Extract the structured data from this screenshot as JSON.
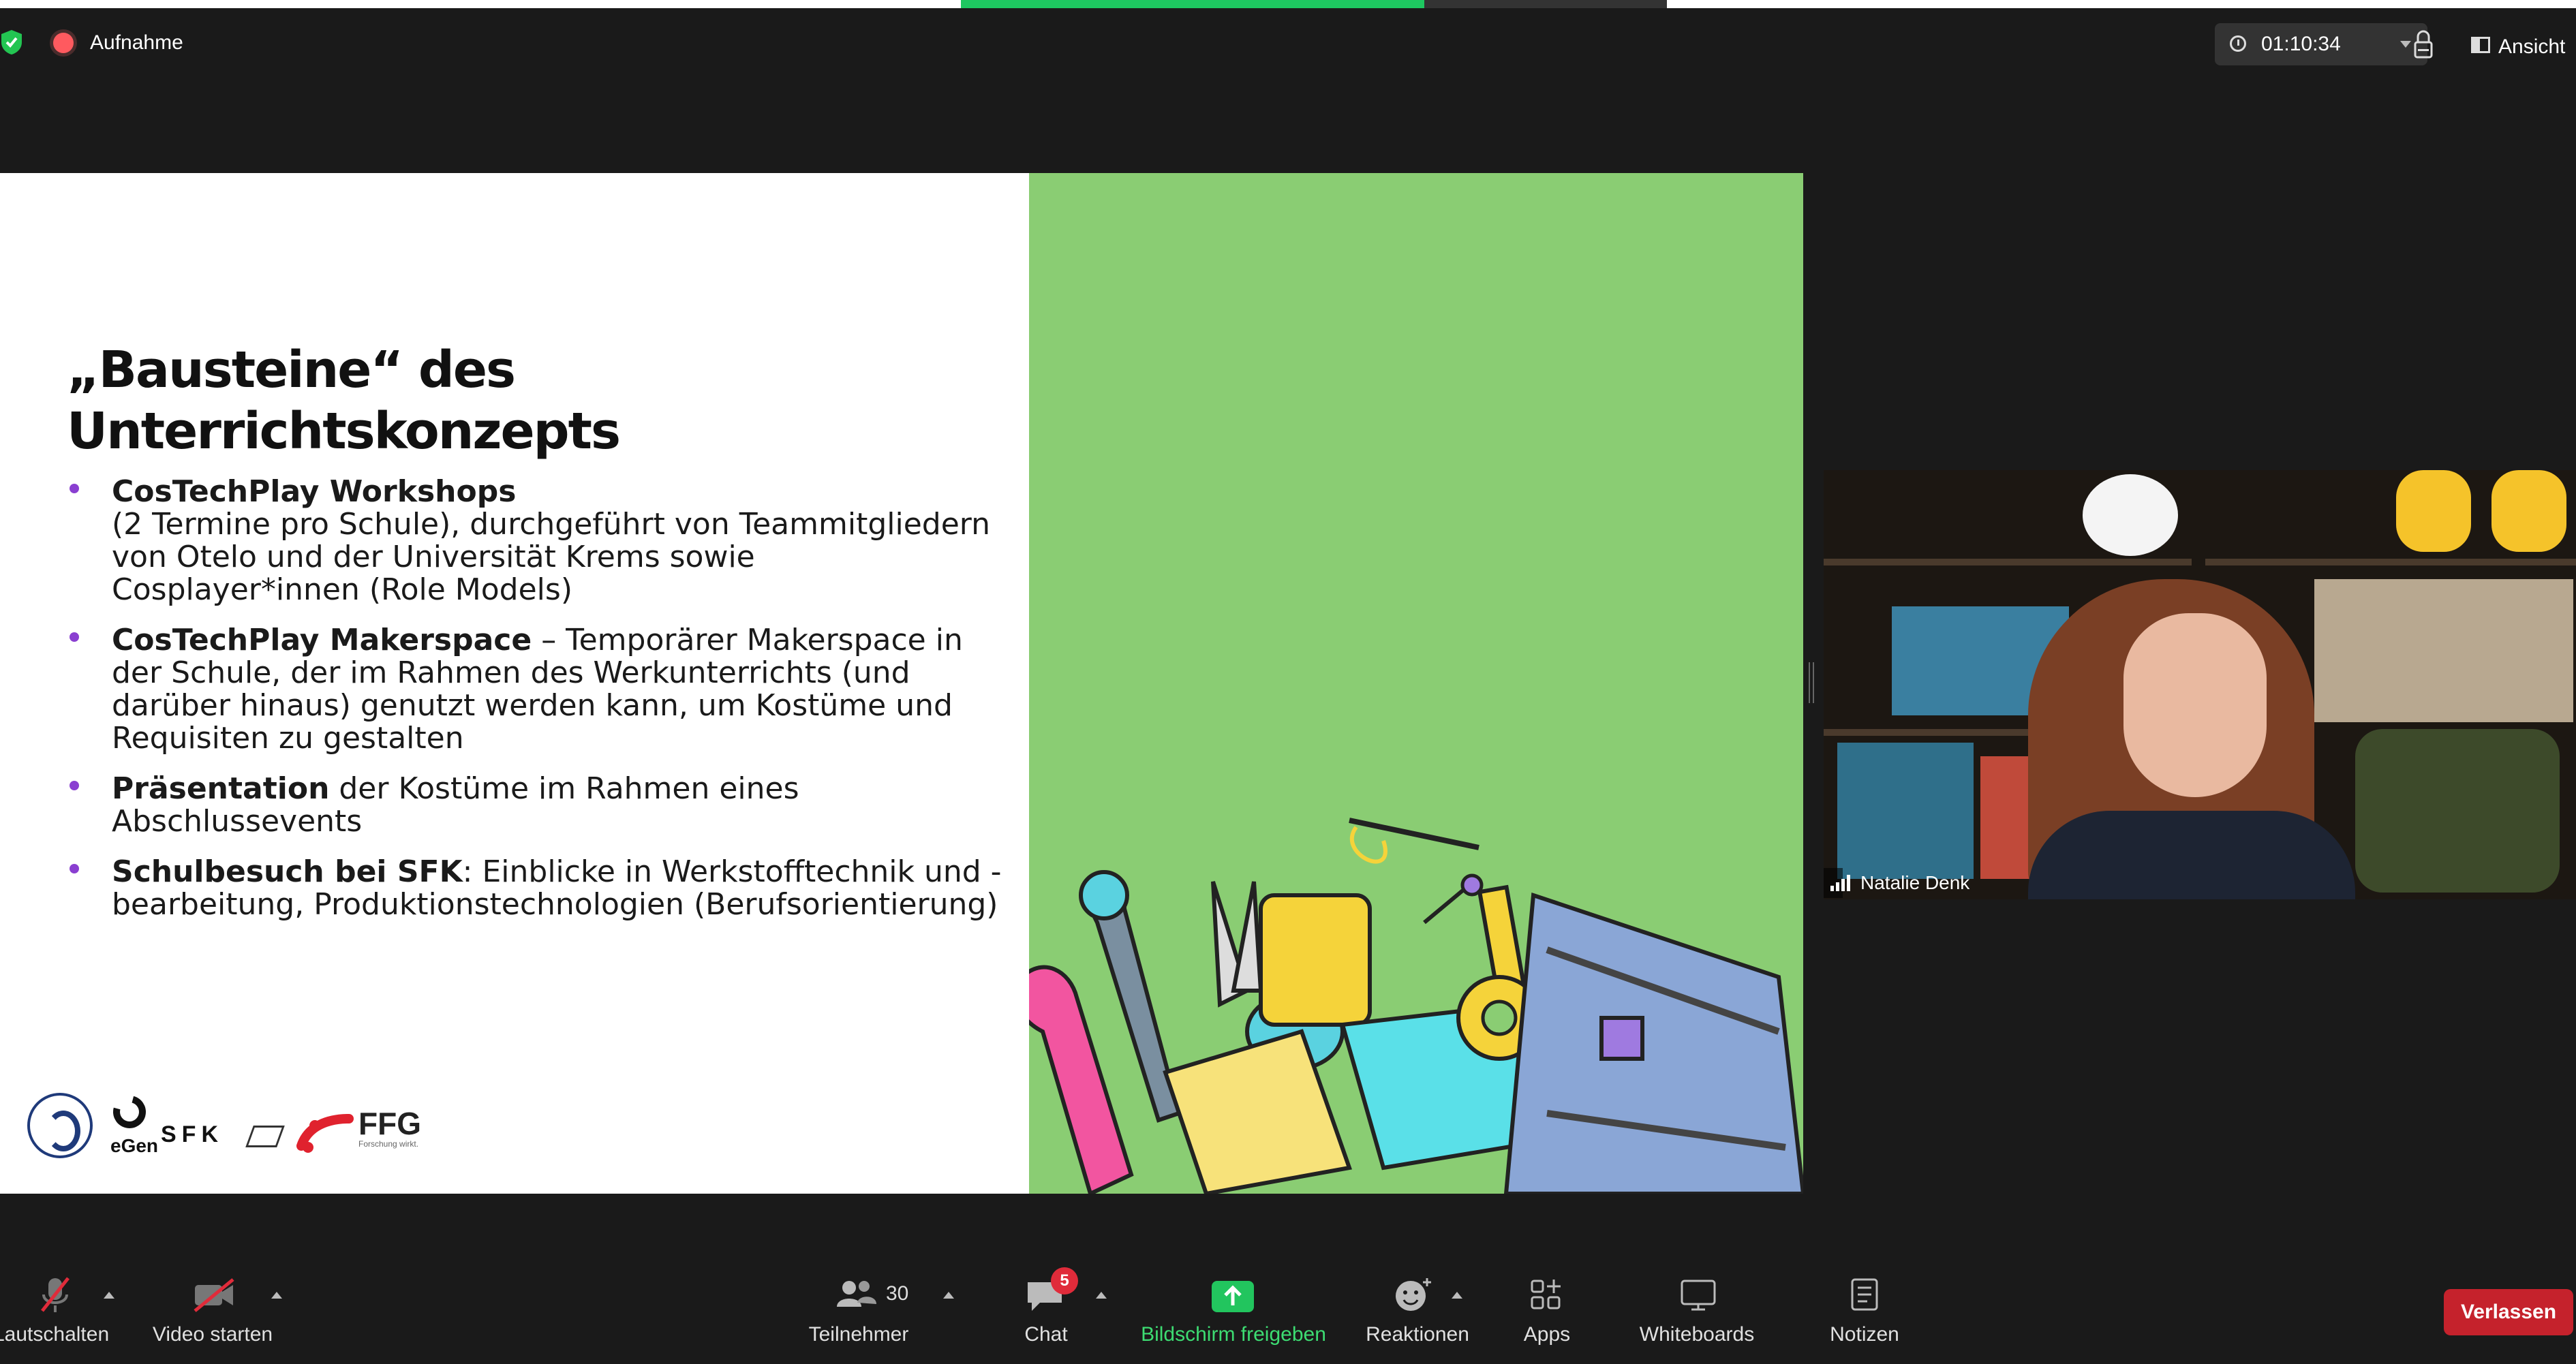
{
  "topbar": {
    "recording_label": "Aufnahme",
    "timer": "01:10:34",
    "view_label": "Ansicht"
  },
  "slide": {
    "title_line1": "„Bausteine“ des",
    "title_line2": "Unterrichtskonzepts",
    "bullets": [
      {
        "bold": "CosTechPlay Workshops",
        "text": "(2 Termine pro Schule), durchgeführt von Teammitgliedern von Otelo und der Universität Krems sowie Cosplayer*innen (Role Models)"
      },
      {
        "bold": "CosTechPlay Makerspace",
        "text": " – Temporärer Makerspace in der Schule, der im Rahmen des Werkunterrichts (und darüber hinaus) genutzt werden kann, um Kostüme und Requisiten zu gestalten"
      },
      {
        "bold": "Präsentation",
        "text": " der Kostüme im Rahmen eines Abschlussevents"
      },
      {
        "bold": "Schulbesuch bei SFK",
        "text": ": Einblicke in Werkstofftechnik und -bearbeitung, Produktionstechnologien (Berufsorientierung)"
      }
    ],
    "logos": {
      "egen": "eGen",
      "sfk": "SFK",
      "ffg": "FFG",
      "ffg_sub": "Forschung wirkt."
    }
  },
  "participant": {
    "name": "Natalie Denk"
  },
  "toolbar": {
    "mute": "Lautschalten",
    "video": "Video starten",
    "participants": "Teilnehmer",
    "participants_count": "30",
    "chat": "Chat",
    "chat_badge": "5",
    "share": "Bildschirm freigeben",
    "reactions": "Reaktionen",
    "apps": "Apps",
    "whiteboards": "Whiteboards",
    "notes": "Notizen",
    "leave": "Verlassen"
  },
  "colors": {
    "share_green": "#22c55e",
    "leave_red": "#c5222c",
    "slide_green": "#8acd73",
    "bullet_purple": "#8a3fd1"
  }
}
